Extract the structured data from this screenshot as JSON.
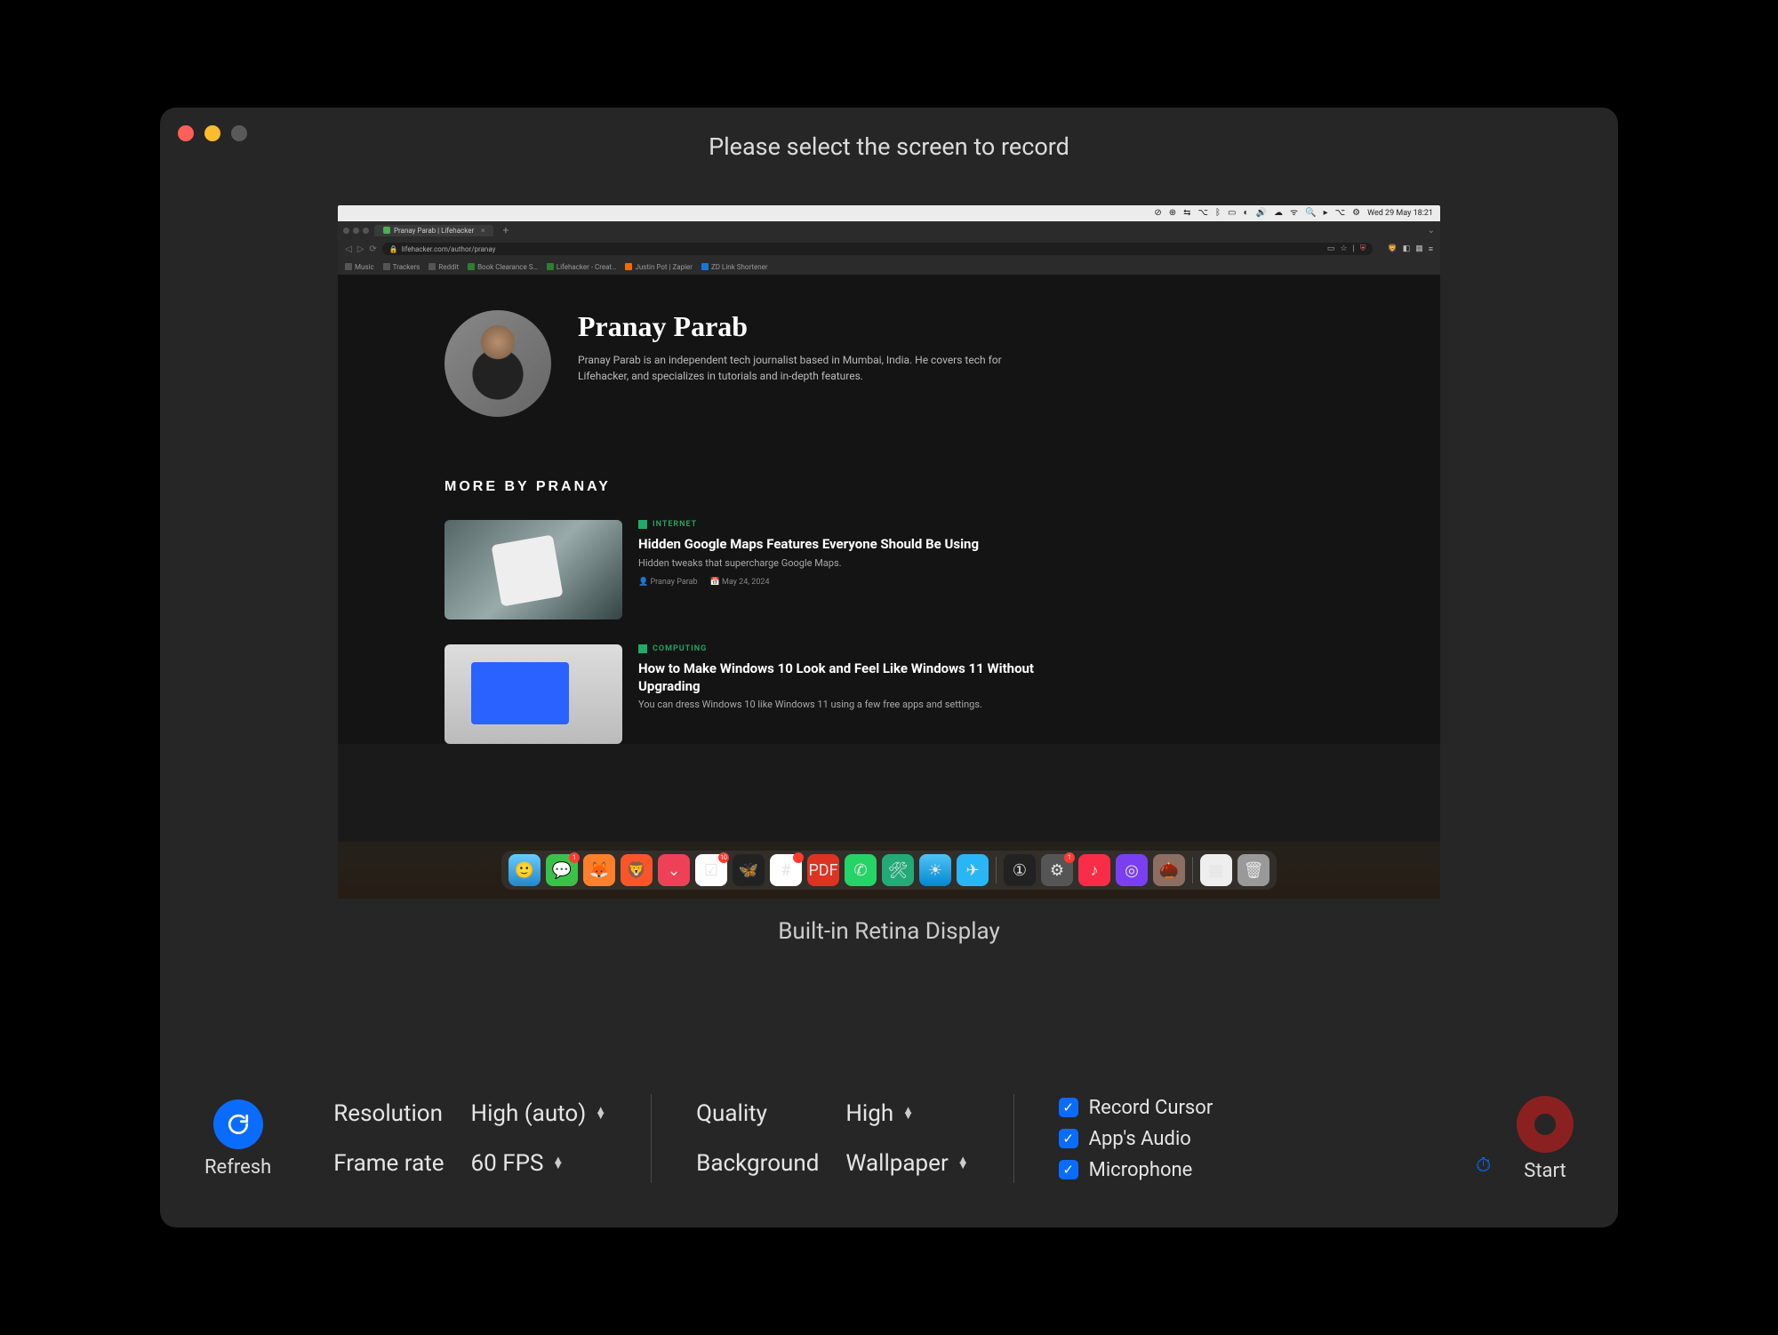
{
  "window": {
    "title": "Please select the screen to record"
  },
  "preview": {
    "menubar": {
      "clock": "Wed 29 May  18:21"
    },
    "browser": {
      "tab_title": "Pranay Parab | Lifehacker",
      "url": "lifehacker.com/author/pranay",
      "bookmarks": [
        "Music",
        "Trackers",
        "Reddit",
        "Book Clearance S…",
        "Lifehacker - Creat…",
        "Justin Pot | Zapier",
        "ZD Link Shortener"
      ]
    },
    "page": {
      "author_name": "Pranay Parab",
      "author_bio": "Pranay Parab is an independent tech journalist based in Mumbai, India. He covers tech for Lifehacker, and specializes in tutorials and in-depth features.",
      "section_title": "MORE BY PRANAY",
      "articles": [
        {
          "category": "INTERNET",
          "title": "Hidden Google Maps Features Everyone Should Be Using",
          "desc": "Hidden tweaks that supercharge Google Maps.",
          "author": "Pranay Parab",
          "date": "May 24, 2024"
        },
        {
          "category": "COMPUTING",
          "title": "How to Make Windows 10 Look and Feel Like Windows 11 Without Upgrading",
          "desc": "You can dress Windows 10 like Windows 11 using a few free apps and settings.",
          "author": "",
          "date": ""
        }
      ]
    },
    "screen_name": "Built-in Retina Display"
  },
  "controls": {
    "refresh_label": "Refresh",
    "resolution": {
      "label": "Resolution",
      "value": "High (auto)"
    },
    "framerate": {
      "label": "Frame rate",
      "value": "60 FPS"
    },
    "quality": {
      "label": "Quality",
      "value": "High"
    },
    "background": {
      "label": "Background",
      "value": "Wallpaper"
    },
    "checkboxes": {
      "cursor": "Record Cursor",
      "audio": "App's Audio",
      "mic": "Microphone"
    },
    "start_label": "Start"
  }
}
